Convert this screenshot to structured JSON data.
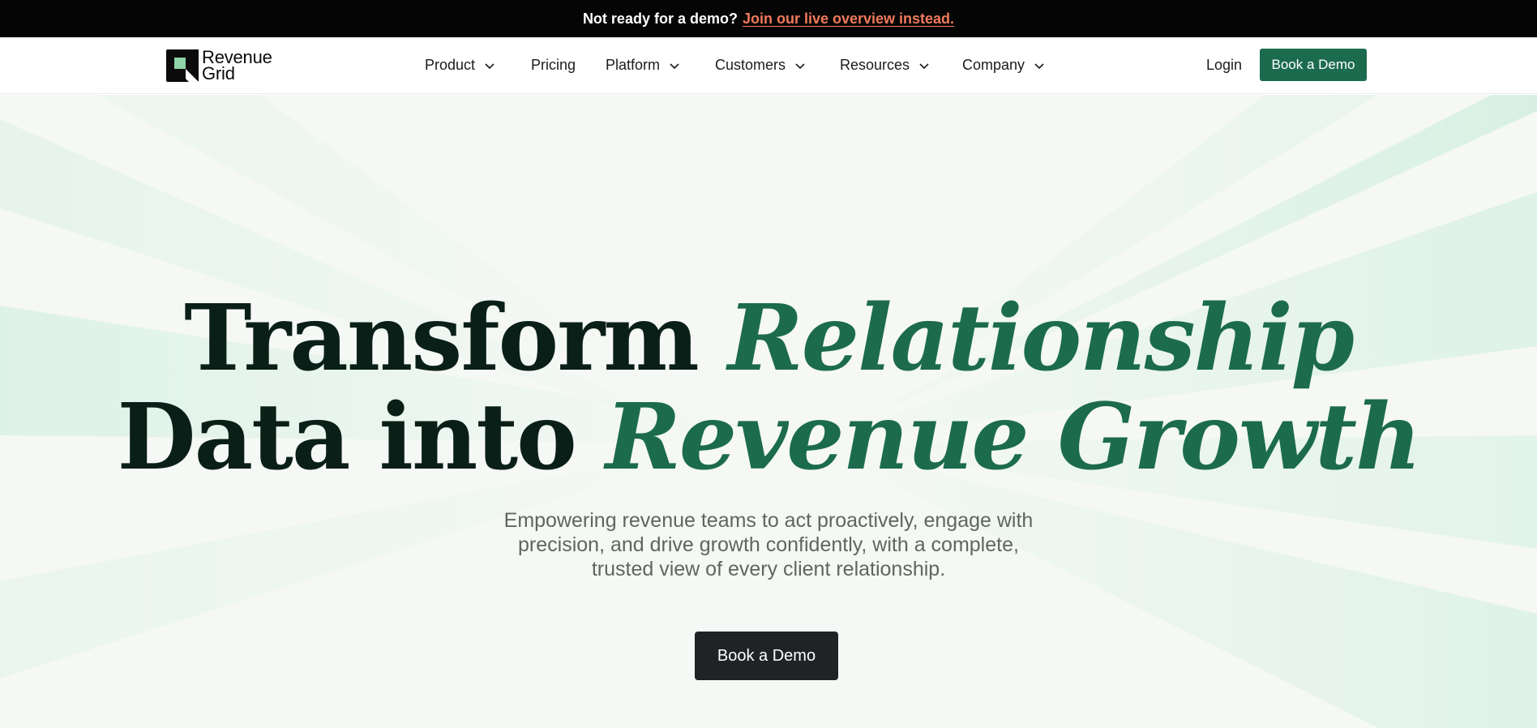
{
  "announcement": {
    "lead": "Not ready for a demo?",
    "link": "Join our live overview instead."
  },
  "brand": {
    "logo_line1": "Revenue",
    "logo_line2": "Grid",
    "logo_icon": "revenue-grid-logo-icon"
  },
  "nav": {
    "items": [
      {
        "label": "Product",
        "has_dropdown": true
      },
      {
        "label": "Pricing",
        "has_dropdown": false
      },
      {
        "label": "Platform",
        "has_dropdown": true
      },
      {
        "label": "Customers",
        "has_dropdown": true
      },
      {
        "label": "Resources",
        "has_dropdown": true
      },
      {
        "label": "Company",
        "has_dropdown": true
      }
    ],
    "login": "Login",
    "cta": "Book a Demo"
  },
  "hero": {
    "headline_part1": "Transform ",
    "headline_accent1": "Relationship",
    "headline_part2": "Data into ",
    "headline_accent2": "Revenue Growth",
    "subtitle": "Empowering revenue teams to act proactively, engage with precision, and drive growth confidently, with a complete, trusted view of every client relationship.",
    "cta": "Book a Demo"
  },
  "colors": {
    "announcement_bg": "#050505",
    "announcement_link": "#f07a5c",
    "brand_green": "#1c6b4f",
    "hero_bg": "#f5f8f5",
    "hero_cta_bg": "#1f2326",
    "headline_text": "#0a1f17"
  }
}
